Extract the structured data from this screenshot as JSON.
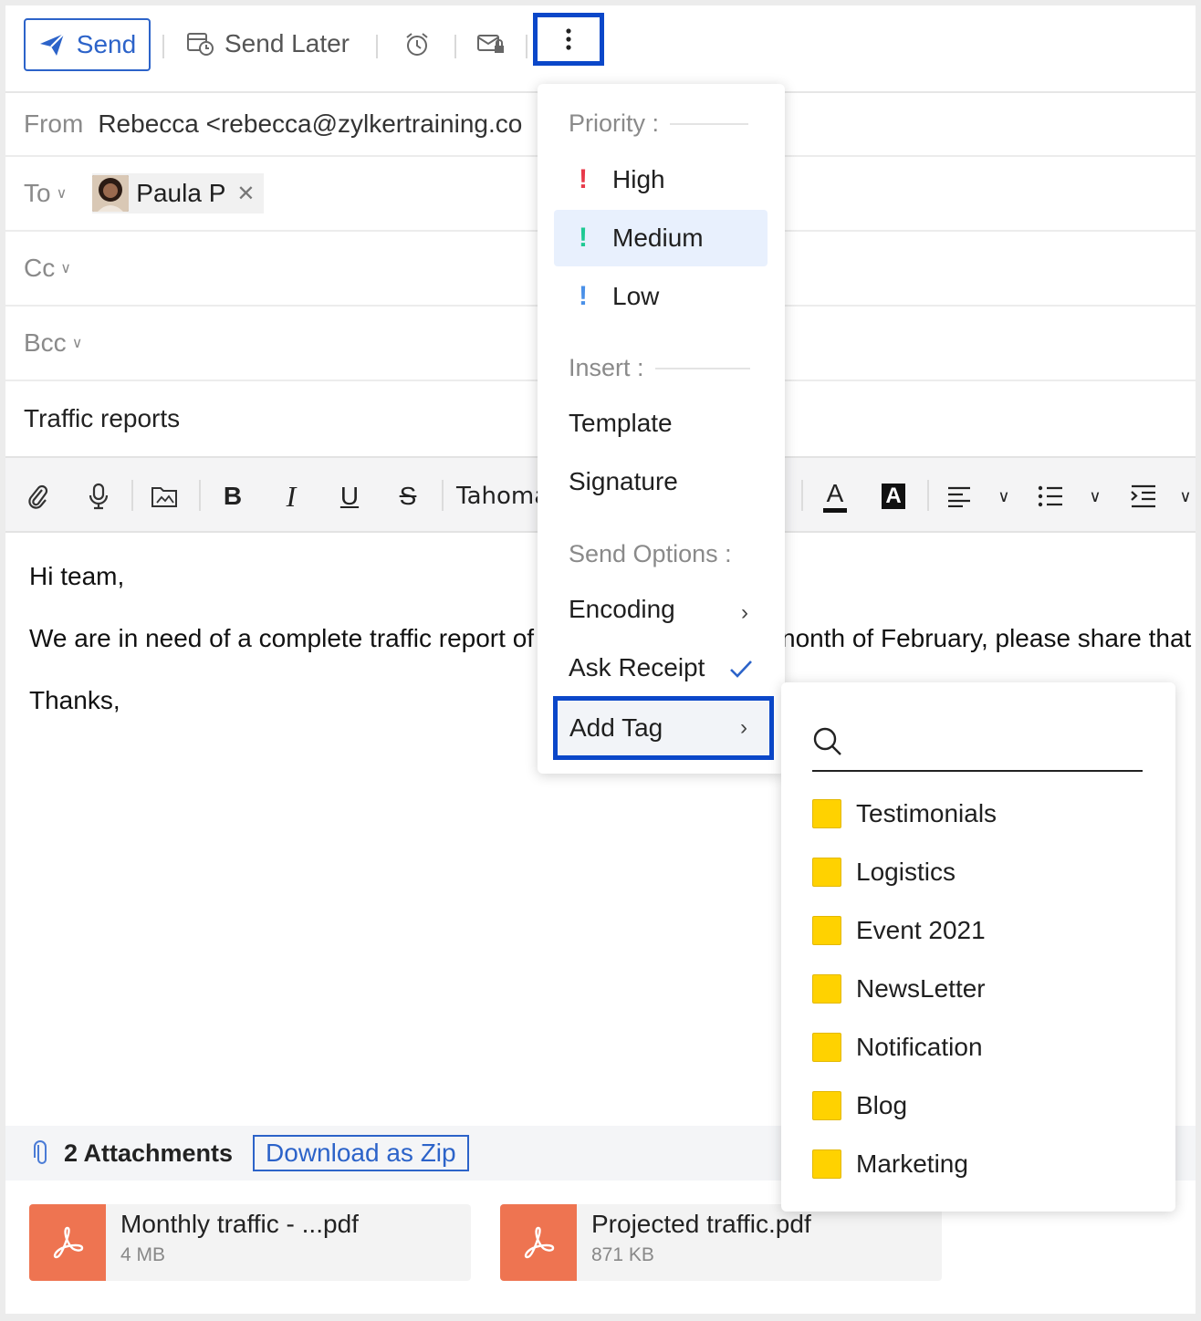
{
  "toolbar": {
    "send_label": "Send",
    "send_later_label": "Send Later"
  },
  "header": {
    "from_label": "From",
    "from_value": "Rebecca <rebecca@zylkertraining.co",
    "to_label": "To",
    "to_chip": "Paula P",
    "cc_label": "Cc",
    "bcc_label": "Bcc",
    "subject": "Traffic reports"
  },
  "format_bar": {
    "font_name": "Tahoma"
  },
  "body": {
    "line1": "Hi team,",
    "line2a": "We are in need of a complete traffic report of",
    "line2b": "nonth of February, please share that",
    "line3": "Thanks,"
  },
  "attachments": {
    "count_label": "2 Attachments",
    "download_label": "Download as Zip",
    "files": [
      {
        "name": "Monthly traffic - ...pdf",
        "size": "4 MB"
      },
      {
        "name": "Projected traffic.pdf",
        "size": "871 KB"
      }
    ]
  },
  "menu": {
    "priority_label": "Priority :",
    "priorities": [
      {
        "label": "High",
        "color": "#e8394a"
      },
      {
        "label": "Medium",
        "color": "#1ec993",
        "selected": true
      },
      {
        "label": "Low",
        "color": "#4a90e8"
      }
    ],
    "insert_label": "Insert :",
    "template_label": "Template",
    "signature_label": "Signature",
    "send_options_label": "Send Options :",
    "encoding_label": "Encoding",
    "ask_receipt_label": "Ask Receipt",
    "add_tag_label": "Add Tag"
  },
  "tags": {
    "items": [
      "Testimonials",
      "Logistics",
      "Event 2021",
      "NewsLetter",
      "Notification",
      "Blog",
      "Marketing"
    ],
    "color": "#ffd200"
  },
  "colors": {
    "accent": "#2c63c9",
    "highlight_border": "#0b47c9",
    "pdf": "#ee7451"
  }
}
